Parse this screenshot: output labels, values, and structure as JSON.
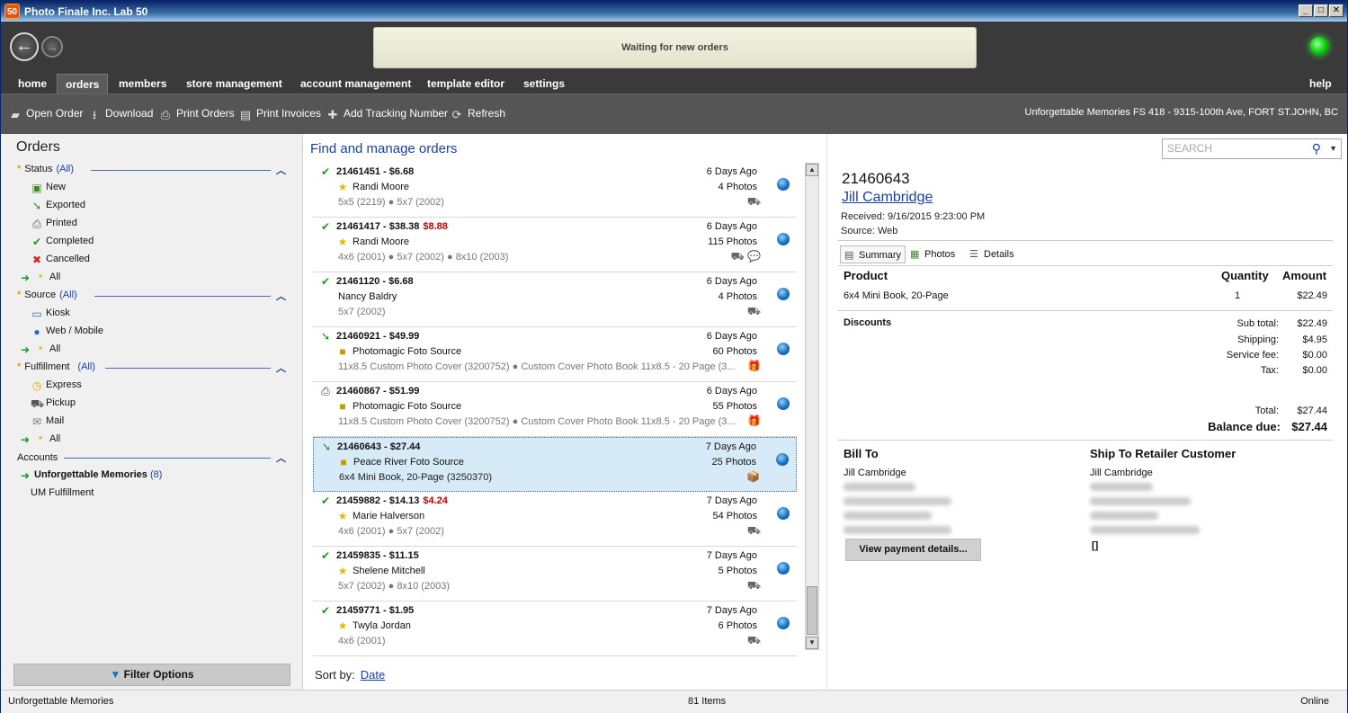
{
  "window": {
    "title": "Photo Finale Inc. Lab 50",
    "icon_text": "50",
    "min": "_",
    "max": "□",
    "close": "✕"
  },
  "header": {
    "status_text": "Waiting for new orders",
    "back_icon": "arrow-left-icon",
    "forward_icon": "arrow-right-icon",
    "connection_color": "#1adb1a"
  },
  "tabs": [
    {
      "label": "home"
    },
    {
      "label": "orders"
    },
    {
      "label": "members"
    },
    {
      "label": "store management"
    },
    {
      "label": "account management"
    },
    {
      "label": "template editor"
    },
    {
      "label": "settings"
    }
  ],
  "help_label": "help",
  "toolbar": {
    "open_order": "Open Order",
    "download": "Download",
    "print_orders": "Print Orders",
    "print_invoices": "Print Invoices",
    "add_tracking": "Add Tracking Number",
    "refresh": "Refresh",
    "store_info": "Unforgettable Memories FS 418 - 9315-100th Ave, FORT ST.JOHN, BC"
  },
  "left": {
    "title": "Orders",
    "status": {
      "label": "Status",
      "all": "(All)",
      "items": [
        "New",
        "Exported",
        "Printed",
        "Completed",
        "Cancelled"
      ],
      "all_item": "All"
    },
    "source": {
      "label": "Source",
      "all": "(All)",
      "items": [
        "Kiosk",
        "Web / Mobile"
      ],
      "all_item": "All"
    },
    "fulfillment": {
      "label": "Fulfillment",
      "all": "(All)",
      "items": [
        "Express",
        "Pickup",
        "Mail"
      ],
      "all_item": "All"
    },
    "accounts": {
      "label": "Accounts",
      "primary": "Unforgettable Memories",
      "primary_count": "(8)",
      "secondary": "UM Fulfillment"
    },
    "filter_button": "Filter Options"
  },
  "middle": {
    "title": "Find and manage orders",
    "sort_label": "Sort by:",
    "sort_value": "Date",
    "orders": [
      {
        "id": "21461451 - $6.68",
        "extra": "",
        "customer": "Randi Moore",
        "ago": "6 Days Ago",
        "photos": "4 Photos",
        "products": "5x5 (2219) ● 5x7 (2002)",
        "status": "completed",
        "icons": "car"
      },
      {
        "id": "21461417 - $38.38",
        "extra": "$8.88",
        "customer": "Randi Moore",
        "ago": "6 Days Ago",
        "photos": "115 Photos",
        "products": "4x6 (2001) ● 5x7 (2002) ● 8x10 (2003)",
        "status": "completed",
        "icons": "car chat"
      },
      {
        "id": "21461120 - $6.68",
        "extra": "",
        "customer": "Nancy Baldry",
        "ago": "6 Days Ago",
        "photos": "4 Photos",
        "products": "5x7 (2002)",
        "status": "completed",
        "icons": "car"
      },
      {
        "id": "21460921 - $49.99",
        "extra": "",
        "customer": "Photomagic Foto Source",
        "ago": "6 Days Ago",
        "photos": "60 Photos",
        "products": "11x8.5 Custom Photo Cover (3200752) ● Custom Cover Photo Book 11x8.5 - 20 Page (3...",
        "status": "exported",
        "icons": "gift"
      },
      {
        "id": "21460867 - $51.99",
        "extra": "",
        "customer": "Photomagic Foto Source",
        "ago": "6 Days Ago",
        "photos": "55 Photos",
        "products": "11x8.5 Custom Photo Cover (3200752) ● Custom Cover Photo Book 11x8.5 - 20 Page (3...",
        "status": "printed",
        "icons": "gift"
      },
      {
        "id": "21460643 - $27.44",
        "extra": "",
        "customer": "Peace River Foto Source",
        "ago": "7 Days Ago",
        "photos": "25 Photos",
        "products": "6x4 Mini Book, 20-Page (3250370)",
        "status": "exported",
        "icons": "ship"
      },
      {
        "id": "21459882 - $14.13",
        "extra": "$4.24",
        "customer": "Marie Halverson",
        "ago": "7 Days Ago",
        "photos": "54 Photos",
        "products": "4x6 (2001) ● 5x7 (2002)",
        "status": "completed",
        "icons": "car"
      },
      {
        "id": "21459835 - $11.15",
        "extra": "",
        "customer": "Shelene Mitchell",
        "ago": "7 Days Ago",
        "photos": "5 Photos",
        "products": "5x7 (2002) ● 8x10 (2003)",
        "status": "completed",
        "icons": "car"
      },
      {
        "id": "21459771 - $1.95",
        "extra": "",
        "customer": "Twyla Jordan",
        "ago": "7 Days Ago",
        "photos": "6 Photos",
        "products": "4x6 (2001)",
        "status": "completed",
        "icons": "car"
      }
    ]
  },
  "right": {
    "search_placeholder": "SEARCH",
    "order_id": "21460643",
    "customer_name": "Jill Cambridge",
    "received": "Received: 9/16/2015 9:23:00 PM",
    "source": "Source: Web",
    "tabs": [
      "Summary",
      "Photos",
      "Details"
    ],
    "col_product": "Product",
    "col_quantity": "Quantity",
    "col_amount": "Amount",
    "line_product": "6x4 Mini Book, 20-Page",
    "line_qty": "1",
    "line_amount": "$22.49",
    "discounts": "Discounts",
    "subtotal_label": "Sub total:",
    "subtotal": "$22.49",
    "shipping_label": "Shipping:",
    "shipping": "$4.95",
    "servicefee_label": "Service fee:",
    "servicefee": "$0.00",
    "tax_label": "Tax:",
    "tax": "$0.00",
    "total_label": "Total:",
    "total": "$27.44",
    "balance_label": "Balance due:",
    "balance": "$27.44",
    "bill_to": "Bill To",
    "bill_name": "Jill Cambridge",
    "ship_to": "Ship To Retailer Customer",
    "ship_name": "Jill Cambridge",
    "ship_extra": "[]",
    "pay_button": "View payment details..."
  },
  "statusbar": {
    "left": "Unforgettable Memories",
    "center": "81 Items",
    "right": "Online"
  }
}
